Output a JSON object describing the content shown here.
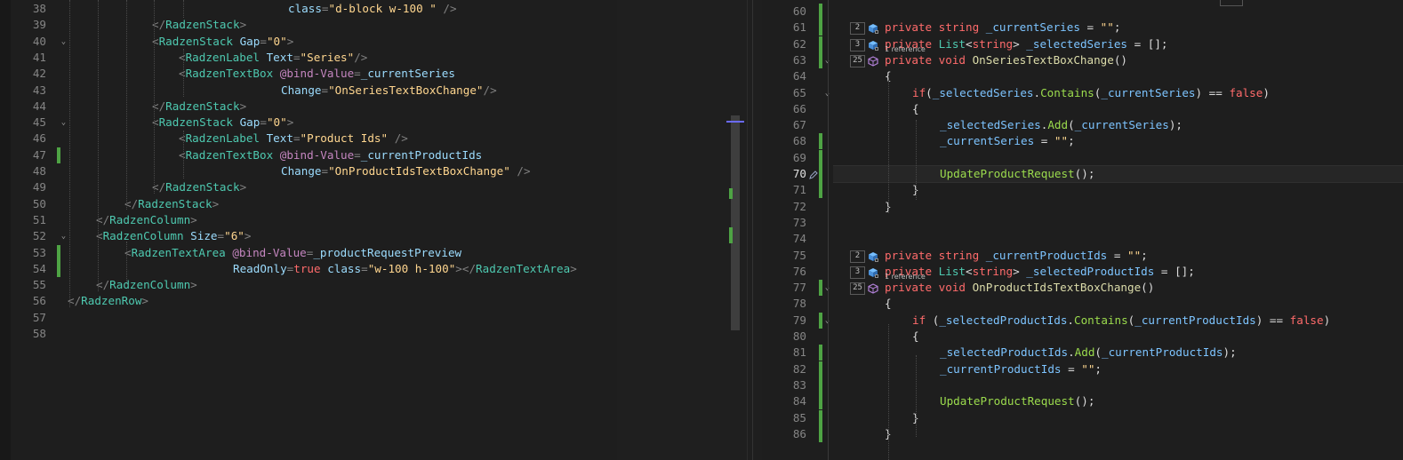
{
  "left_editor": {
    "lines": [
      {
        "num": "38",
        "segs": [
          [
            "at",
            "class"
          ],
          [
            "tag",
            "="
          ],
          [
            "str",
            "\"d-block w-100 \""
          ],
          [
            "tag",
            " />"
          ]
        ],
        "indent": 312,
        "change": false
      },
      {
        "num": "39",
        "segs": [
          [
            "tag",
            "</"
          ],
          [
            "el",
            "RadzenStack"
          ],
          [
            "tag",
            ">"
          ]
        ],
        "indent": 159,
        "change": false
      },
      {
        "num": "40",
        "segs": [
          [
            "tag",
            "<"
          ],
          [
            "el",
            "RadzenStack "
          ],
          [
            "at",
            "Gap"
          ],
          [
            "tag",
            "="
          ],
          [
            "str",
            "\"0\""
          ],
          [
            "tag",
            ">"
          ]
        ],
        "indent": 159,
        "change": false,
        "fold": true
      },
      {
        "num": "41",
        "segs": [
          [
            "tag",
            "<"
          ],
          [
            "el",
            "RadzenLabel "
          ],
          [
            "at",
            "Text"
          ],
          [
            "tag",
            "="
          ],
          [
            "str",
            "\"Series\""
          ],
          [
            "tag",
            "/>"
          ]
        ],
        "indent": 189,
        "change": false
      },
      {
        "num": "42",
        "segs": [
          [
            "tag",
            "<"
          ],
          [
            "el",
            "RadzenTextBox "
          ],
          [
            "rz",
            "@bind-Value"
          ],
          [
            "tag",
            "="
          ],
          [
            "bd",
            "_currentSeries"
          ]
        ],
        "indent": 189,
        "change": false
      },
      {
        "num": "43",
        "segs": [
          [
            "at",
            "Change"
          ],
          [
            "tag",
            "="
          ],
          [
            "str",
            "\"OnSeriesTextBoxChange\""
          ],
          [
            "tag",
            "/>"
          ]
        ],
        "indent": 304,
        "change": false
      },
      {
        "num": "44",
        "segs": [
          [
            "tag",
            "</"
          ],
          [
            "el",
            "RadzenStack"
          ],
          [
            "tag",
            ">"
          ]
        ],
        "indent": 159,
        "change": false
      },
      {
        "num": "45",
        "segs": [
          [
            "tag",
            "<"
          ],
          [
            "el",
            "RadzenStack "
          ],
          [
            "at",
            "Gap"
          ],
          [
            "tag",
            "="
          ],
          [
            "str",
            "\"0\""
          ],
          [
            "tag",
            ">"
          ]
        ],
        "indent": 159,
        "change": false,
        "fold": true
      },
      {
        "num": "46",
        "segs": [
          [
            "tag",
            "<"
          ],
          [
            "el",
            "RadzenLabel "
          ],
          [
            "at",
            "Text"
          ],
          [
            "tag",
            "="
          ],
          [
            "str",
            "\"Product Ids\""
          ],
          [
            "tag",
            " />"
          ]
        ],
        "indent": 189,
        "change": false
      },
      {
        "num": "47",
        "segs": [
          [
            "tag",
            "<"
          ],
          [
            "el",
            "RadzenTextBox "
          ],
          [
            "rz",
            "@bind-Value"
          ],
          [
            "tag",
            "="
          ],
          [
            "bd",
            "_currentProductIds"
          ]
        ],
        "indent": 189,
        "change": true
      },
      {
        "num": "48",
        "segs": [
          [
            "at",
            "Change"
          ],
          [
            "tag",
            "="
          ],
          [
            "str",
            "\"OnProductIdsTextBoxChange\""
          ],
          [
            "tag",
            " />"
          ]
        ],
        "indent": 304,
        "change": false
      },
      {
        "num": "49",
        "segs": [
          [
            "tag",
            "</"
          ],
          [
            "el",
            "RadzenStack"
          ],
          [
            "tag",
            ">"
          ]
        ],
        "indent": 159,
        "change": false
      },
      {
        "num": "50",
        "segs": [
          [
            "tag",
            "</"
          ],
          [
            "el",
            "RadzenStack"
          ],
          [
            "tag",
            ">"
          ]
        ],
        "indent": 128,
        "change": false
      },
      {
        "num": "51",
        "segs": [
          [
            "tag",
            "</"
          ],
          [
            "el",
            "RadzenColumn"
          ],
          [
            "tag",
            ">"
          ]
        ],
        "indent": 96,
        "change": false
      },
      {
        "num": "52",
        "segs": [
          [
            "tag",
            "<"
          ],
          [
            "el",
            "RadzenColumn "
          ],
          [
            "at",
            "Size"
          ],
          [
            "tag",
            "="
          ],
          [
            "str",
            "\"6\""
          ],
          [
            "tag",
            ">"
          ]
        ],
        "indent": 96,
        "change": false,
        "fold": true
      },
      {
        "num": "53",
        "segs": [
          [
            "tag",
            "<"
          ],
          [
            "el",
            "RadzenTextArea "
          ],
          [
            "rz",
            "@bind-Value"
          ],
          [
            "tag",
            "="
          ],
          [
            "bd",
            "_productRequestPreview"
          ]
        ],
        "indent": 128,
        "change": true
      },
      {
        "num": "54",
        "segs": [
          [
            "at",
            "ReadOnly"
          ],
          [
            "tag",
            "="
          ],
          [
            "kw",
            "true "
          ],
          [
            "at",
            "class"
          ],
          [
            "tag",
            "="
          ],
          [
            "str",
            "\"w-100 h-100\""
          ],
          [
            "tag",
            "></"
          ],
          [
            "el",
            "RadzenTextArea"
          ],
          [
            "tag",
            ">"
          ]
        ],
        "indent": 250,
        "change": true
      },
      {
        "num": "55",
        "segs": [
          [
            "tag",
            "</"
          ],
          [
            "el",
            "RadzenColumn"
          ],
          [
            "tag",
            ">"
          ]
        ],
        "indent": 96,
        "change": false
      },
      {
        "num": "56",
        "segs": [
          [
            "tag",
            "</"
          ],
          [
            "el",
            "RadzenRow"
          ],
          [
            "tag",
            ">"
          ]
        ],
        "indent": 64,
        "change": false
      },
      {
        "num": "57",
        "segs": [],
        "indent": 64,
        "change": false
      },
      {
        "num": "58",
        "segs": [],
        "indent": 64,
        "change": false
      }
    ]
  },
  "right_editor": {
    "current_line": "70",
    "lines": [
      {
        "num": "60",
        "segs": [],
        "indent": 138,
        "change": true
      },
      {
        "num": "61",
        "segs": [
          [
            "kw",
            "private "
          ],
          [
            "kw",
            "string "
          ],
          [
            "fld",
            "_currentSeries"
          ],
          [
            "cs",
            " = "
          ],
          [
            "str",
            "\"\""
          ],
          [
            "cs",
            ";"
          ]
        ],
        "indent": 138,
        "change": true,
        "refs": "2",
        "icon": "field"
      },
      {
        "num": "62",
        "segs": [
          [
            "kw",
            "private "
          ],
          [
            "ty",
            "List"
          ],
          [
            "cs",
            "<"
          ],
          [
            "kw",
            "string"
          ],
          [
            "cs",
            "> "
          ],
          [
            "fld",
            "_selectedSeries"
          ],
          [
            "cs",
            " = [];"
          ]
        ],
        "indent": 138,
        "change": true,
        "refs": "3",
        "icon": "field"
      },
      {
        "num": "63",
        "segs": [
          [
            "kw",
            "private "
          ],
          [
            "kw",
            "void "
          ],
          [
            "mth",
            "OnSeriesTextBoxChange"
          ],
          [
            "cs",
            "()"
          ]
        ],
        "indent": 138,
        "change": true,
        "refs": "25",
        "icon": "method",
        "fold": true,
        "refnote": "1 reference"
      },
      {
        "num": "64",
        "segs": [
          [
            "cs",
            "{"
          ]
        ],
        "indent": 138,
        "change": false
      },
      {
        "num": "65",
        "segs": [
          [
            "kw",
            "if"
          ],
          [
            "cs",
            "("
          ],
          [
            "fld",
            "_selectedSeries"
          ],
          [
            "cs",
            "."
          ],
          [
            "fn",
            "Contains"
          ],
          [
            "cs",
            "("
          ],
          [
            "fld",
            "_currentSeries"
          ],
          [
            "cs",
            ") == "
          ],
          [
            "kw",
            "false"
          ],
          [
            "cs",
            ")"
          ]
        ],
        "indent": 169,
        "change": false,
        "fold": true
      },
      {
        "num": "66",
        "segs": [
          [
            "cs",
            "{"
          ]
        ],
        "indent": 169,
        "change": false
      },
      {
        "num": "67",
        "segs": [
          [
            "fld",
            "_selectedSeries"
          ],
          [
            "cs",
            "."
          ],
          [
            "fn",
            "Add"
          ],
          [
            "cs",
            "("
          ],
          [
            "fld",
            "_currentSeries"
          ],
          [
            "cs",
            ");"
          ]
        ],
        "indent": 200,
        "change": false
      },
      {
        "num": "68",
        "segs": [
          [
            "fld",
            "_currentSeries"
          ],
          [
            "cs",
            " = "
          ],
          [
            "str",
            "\"\""
          ],
          [
            "cs",
            ";"
          ]
        ],
        "indent": 200,
        "change": true
      },
      {
        "num": "69",
        "segs": [],
        "indent": 200,
        "change": true
      },
      {
        "num": "70",
        "segs": [
          [
            "fn",
            "UpdateProductRequest"
          ],
          [
            "cs",
            "();"
          ]
        ],
        "indent": 200,
        "change": true,
        "current": true
      },
      {
        "num": "71",
        "segs": [
          [
            "cs",
            "}"
          ]
        ],
        "indent": 169,
        "change": true
      },
      {
        "num": "72",
        "segs": [
          [
            "cs",
            "}"
          ]
        ],
        "indent": 138,
        "change": false
      },
      {
        "num": "73",
        "segs": [],
        "indent": 138,
        "change": false
      },
      {
        "num": "74",
        "segs": [],
        "indent": 138,
        "change": false
      },
      {
        "num": "75",
        "segs": [
          [
            "kw",
            "private "
          ],
          [
            "kw",
            "string "
          ],
          [
            "fld",
            "_currentProductIds"
          ],
          [
            "cs",
            " = "
          ],
          [
            "str",
            "\"\""
          ],
          [
            "cs",
            ";"
          ]
        ],
        "indent": 138,
        "change": false,
        "refs": "2",
        "icon": "field"
      },
      {
        "num": "76",
        "segs": [
          [
            "kw",
            "private "
          ],
          [
            "ty",
            "List"
          ],
          [
            "cs",
            "<"
          ],
          [
            "kw",
            "string"
          ],
          [
            "cs",
            "> "
          ],
          [
            "fld",
            "_selectedProductIds"
          ],
          [
            "cs",
            " = [];"
          ]
        ],
        "indent": 138,
        "change": false,
        "refs": "3",
        "icon": "field"
      },
      {
        "num": "77",
        "segs": [
          [
            "kw",
            "private "
          ],
          [
            "kw",
            "void "
          ],
          [
            "mth",
            "OnProductIdsTextBoxChange"
          ],
          [
            "cs",
            "()"
          ]
        ],
        "indent": 138,
        "change": true,
        "refs": "25",
        "icon": "method",
        "fold": true,
        "refnote": "1 reference"
      },
      {
        "num": "78",
        "segs": [
          [
            "cs",
            "{"
          ]
        ],
        "indent": 138,
        "change": false
      },
      {
        "num": "79",
        "segs": [
          [
            "kw",
            "if "
          ],
          [
            "cs",
            "("
          ],
          [
            "fld",
            "_selectedProductIds"
          ],
          [
            "cs",
            "."
          ],
          [
            "fn",
            "Contains"
          ],
          [
            "cs",
            "("
          ],
          [
            "fld",
            "_currentProductIds"
          ],
          [
            "cs",
            ") == "
          ],
          [
            "kw",
            "false"
          ],
          [
            "cs",
            ")"
          ]
        ],
        "indent": 169,
        "change": true,
        "fold": true
      },
      {
        "num": "80",
        "segs": [
          [
            "cs",
            "{"
          ]
        ],
        "indent": 169,
        "change": false
      },
      {
        "num": "81",
        "segs": [
          [
            "fld",
            "_selectedProductIds"
          ],
          [
            "cs",
            "."
          ],
          [
            "fn",
            "Add"
          ],
          [
            "cs",
            "("
          ],
          [
            "fld",
            "_currentProductIds"
          ],
          [
            "cs",
            ");"
          ]
        ],
        "indent": 200,
        "change": true
      },
      {
        "num": "82",
        "segs": [
          [
            "fld",
            "_currentProductIds"
          ],
          [
            "cs",
            " = "
          ],
          [
            "str",
            "\"\""
          ],
          [
            "cs",
            ";"
          ]
        ],
        "indent": 200,
        "change": true
      },
      {
        "num": "83",
        "segs": [],
        "indent": 200,
        "change": true
      },
      {
        "num": "84",
        "segs": [
          [
            "fn",
            "UpdateProductRequest"
          ],
          [
            "cs",
            "();"
          ]
        ],
        "indent": 200,
        "change": true
      },
      {
        "num": "85",
        "segs": [
          [
            "cs",
            "}"
          ]
        ],
        "indent": 169,
        "change": true
      },
      {
        "num": "86",
        "segs": [
          [
            "cs",
            "}"
          ]
        ],
        "indent": 138,
        "change": true
      }
    ]
  }
}
